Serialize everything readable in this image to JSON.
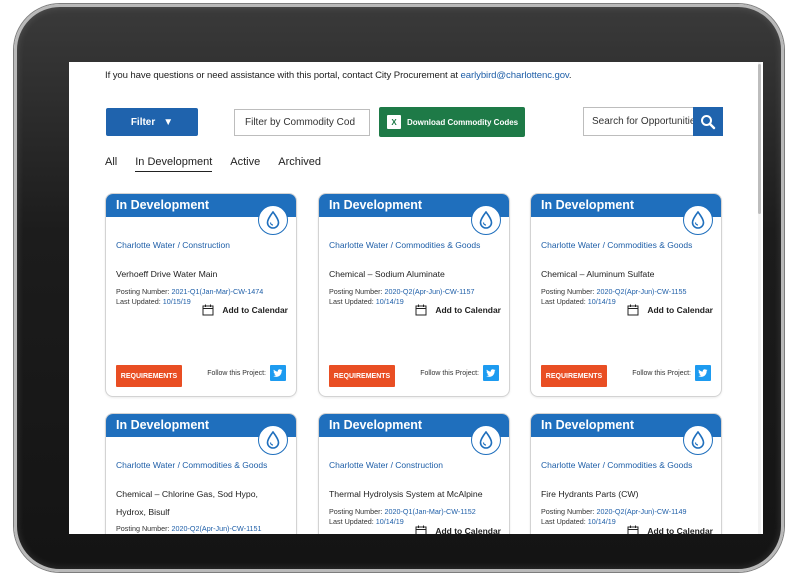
{
  "contact": {
    "text": "If you have questions or need assistance with this portal, contact City Procurement at ",
    "email": "earlybird@charlottenc.gov",
    "suffix": "."
  },
  "toolbar": {
    "filter_label": "Filter",
    "commodity_filter_value": "Filter by Commodity Cod",
    "download_label": "Download Commodity Codes",
    "excel_icon_text": "X",
    "search_value": "Search for Opportunitie"
  },
  "tabs": [
    {
      "label": "All"
    },
    {
      "label": "In Development",
      "active": true
    },
    {
      "label": "Active"
    },
    {
      "label": "Archived"
    }
  ],
  "common": {
    "posting_label": "Posting Number: ",
    "updated_label": "Last Updated: ",
    "add_calendar": "Add to Calendar",
    "requirements": "REQUIREMENTS",
    "follow": "Follow this Project:"
  },
  "cards": [
    {
      "status": "In Development",
      "category": "Charlotte Water / Construction",
      "title": "Verhoeff Drive Water Main",
      "posting": "2021-Q1(Jan-Mar)-CW-1474",
      "updated": "10/15/19"
    },
    {
      "status": "In Development",
      "category": "Charlotte Water / Commodities & Goods",
      "title": "Chemical – Sodium Aluminate",
      "posting": "2020-Q2(Apr-Jun)-CW-1157",
      "updated": "10/14/19"
    },
    {
      "status": "In Development",
      "category": "Charlotte Water / Commodities & Goods",
      "title": "Chemical – Aluminum Sulfate",
      "posting": "2020-Q2(Apr-Jun)-CW-1155",
      "updated": "10/14/19"
    },
    {
      "status": "In Development",
      "category": "Charlotte Water / Commodities & Goods",
      "title": "Chemical – Chlorine Gas, Sod Hypo, Hydrox, Bisulf",
      "posting": "2020-Q2(Apr-Jun)-CW-1151",
      "updated": ""
    },
    {
      "status": "In Development",
      "category": "Charlotte Water / Construction",
      "title": "Thermal Hydrolysis System at McAlpine",
      "posting": "2020-Q1(Jan-Mar)-CW-1152",
      "updated": "10/14/19"
    },
    {
      "status": "In Development",
      "category": "Charlotte Water / Commodities & Goods",
      "title": "Fire Hydrants Parts (CW)",
      "posting": "2020-Q2(Apr-Jun)-CW-1149",
      "updated": "10/14/19"
    }
  ],
  "colors": {
    "brand_blue": "#1f6fbd",
    "download_green": "#1e7a47",
    "requirements_orange": "#e94e23",
    "twitter_blue": "#1d9bf0"
  }
}
